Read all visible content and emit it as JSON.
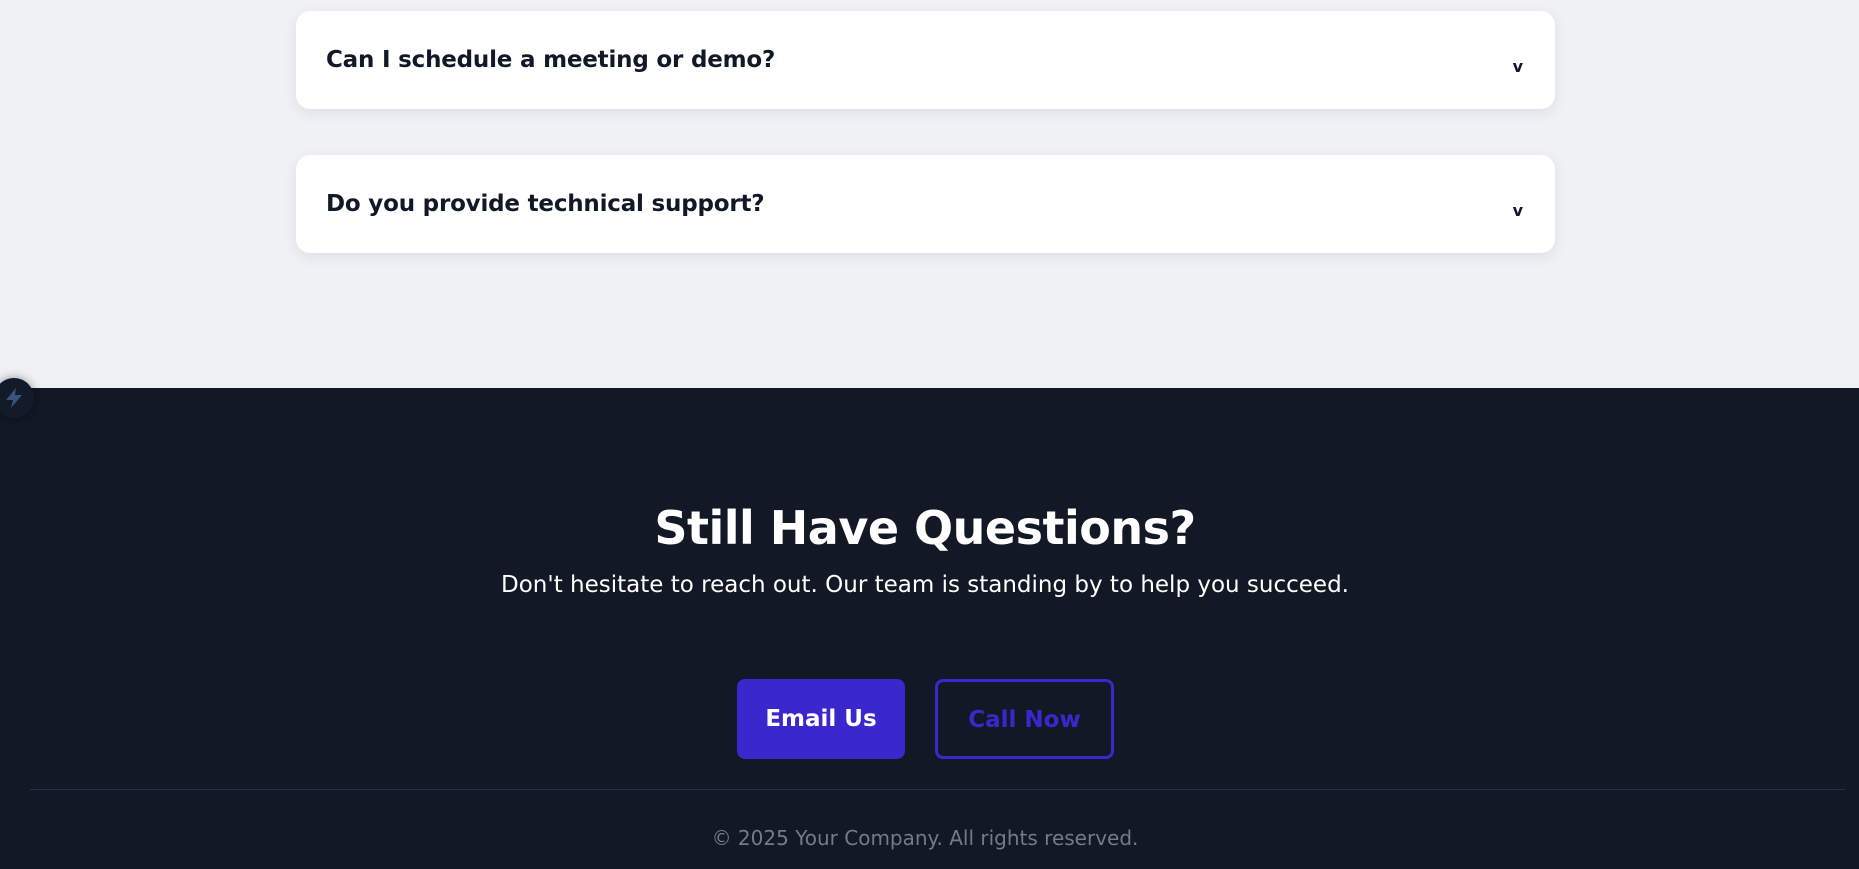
{
  "faq": {
    "items": [
      {
        "question": "Can I schedule a meeting or demo?",
        "chevron": "v"
      },
      {
        "question": "Do you provide technical support?",
        "chevron": "v"
      }
    ]
  },
  "cta": {
    "title": "Still Have Questions?",
    "subtitle": "Don't hesitate to reach out. Our team is standing by to help you succeed.",
    "email_button": "Email Us",
    "call_button": "Call Now"
  },
  "footer": {
    "copyright": "© 2025 Your Company. All rights reserved."
  },
  "colors": {
    "primary": "#3b28cc",
    "dark_bg": "#121826",
    "light_bg": "#eff1f5"
  },
  "icons": {
    "floating_widget": "lightning-bolt-icon"
  }
}
